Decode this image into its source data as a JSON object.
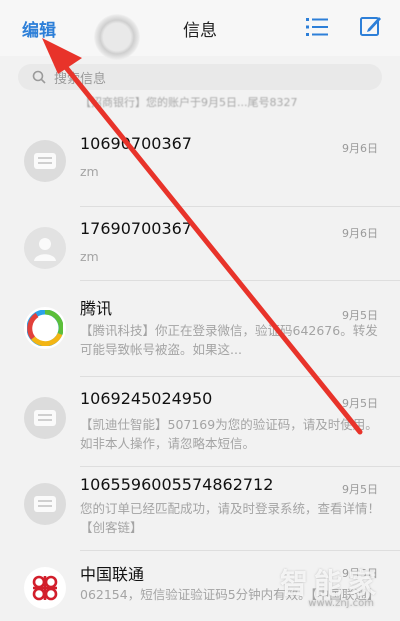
{
  "header": {
    "edit_label": "编辑",
    "title": "信息"
  },
  "search": {
    "placeholder": "搜索信息"
  },
  "faded_preview": "【招商银行】您的账户于9月5日...尾号8327",
  "messages": [
    {
      "sender": "10690700367",
      "date": "9月6日",
      "preview": "zm"
    },
    {
      "sender": "17690700367",
      "date": "9月6日",
      "preview": "zm"
    },
    {
      "sender": "腾讯",
      "date": "9月5日",
      "preview": "【腾讯科技】你正在登录微信，验证码642676。转发可能导致帐号被盗。如果这..."
    },
    {
      "sender": "1069245024950",
      "date": "9月5日",
      "preview": "【凯迪仕智能】507169为您的验证码，请及时使用。如非本人操作，请忽略本短信。"
    },
    {
      "sender": "1065596005574862712",
      "date": "9月5日",
      "preview": "您的订单已经匹配成功，请及时登录系统，查看详情！【创客链】"
    },
    {
      "sender": "中国联通",
      "date": "9月5日",
      "preview": "062154，短信验证验证码5分钟内有效。【中国联通】"
    }
  ],
  "watermark": {
    "big": "智能家",
    "small": "www.znj.com"
  },
  "colors": {
    "accent": "#2d7fd8",
    "arrow": "#e8332a"
  }
}
